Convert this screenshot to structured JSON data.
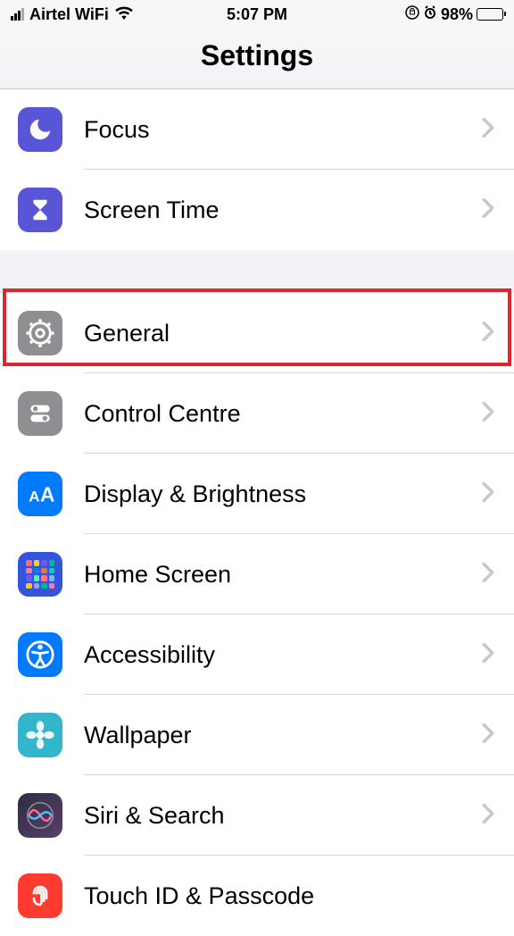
{
  "status": {
    "carrier": "Airtel WiFi",
    "time": "5:07 PM",
    "battery": "98%"
  },
  "header": {
    "title": "Settings"
  },
  "rows": {
    "focus": "Focus",
    "screentime": "Screen Time",
    "general": "General",
    "control": "Control Centre",
    "display": "Display & Brightness",
    "home": "Home Screen",
    "accessibility": "Accessibility",
    "wallpaper": "Wallpaper",
    "siri": "Siri & Search",
    "touchid": "Touch ID & Passcode"
  }
}
